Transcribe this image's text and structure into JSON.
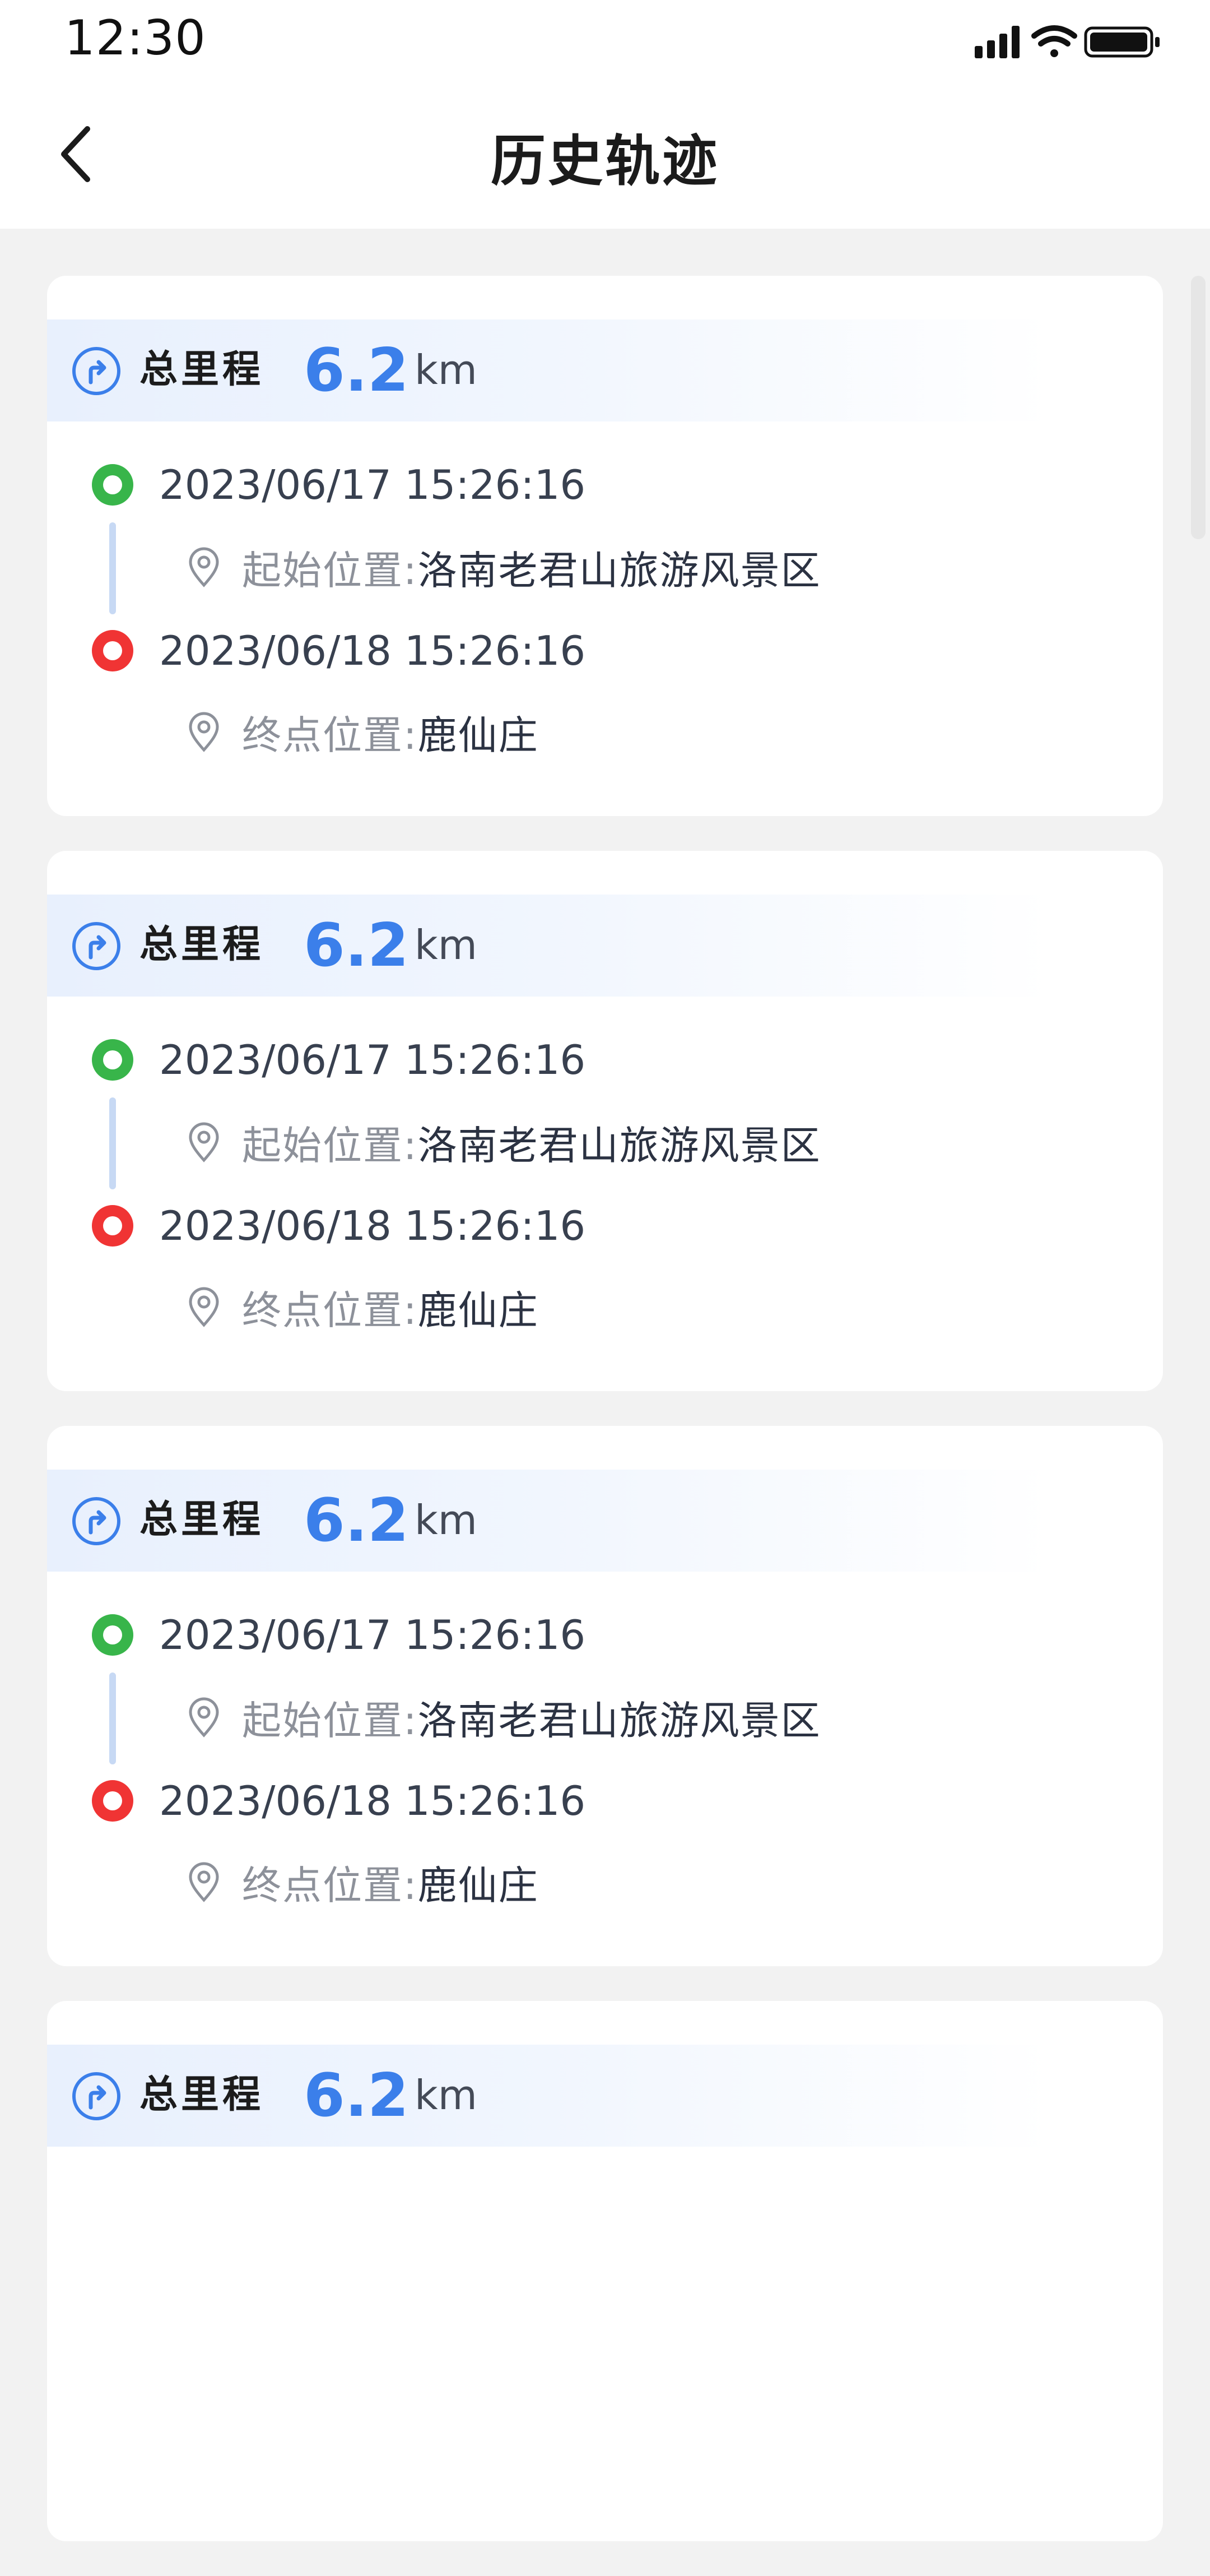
{
  "status_bar": {
    "time": "12:30",
    "icons": [
      "signal-icon",
      "wifi-icon",
      "battery-icon"
    ]
  },
  "nav": {
    "back_icon": "chevron-left-icon",
    "title": "历史轨迹"
  },
  "colors": {
    "accent": "#3b7fea",
    "start": "#38b54a",
    "end": "#f03434",
    "timeline": "#c7d9f4",
    "background": "#f2f2f2"
  },
  "trips": [
    {
      "total_label": "总里程",
      "distance": "6.2",
      "unit": "km",
      "start_time": "2023/06/17 15:26:16",
      "start_label": "起始位置:",
      "start_location": "洛南老君山旅游风景区",
      "end_time": "2023/06/18 15:26:16",
      "end_label": "终点位置:",
      "end_location": "鹿仙庄"
    },
    {
      "total_label": "总里程",
      "distance": "6.2",
      "unit": "km",
      "start_time": "2023/06/17 15:26:16",
      "start_label": "起始位置:",
      "start_location": "洛南老君山旅游风景区",
      "end_time": "2023/06/18 15:26:16",
      "end_label": "终点位置:",
      "end_location": "鹿仙庄"
    },
    {
      "total_label": "总里程",
      "distance": "6.2",
      "unit": "km",
      "start_time": "2023/06/17 15:26:16",
      "start_label": "起始位置:",
      "start_location": "洛南老君山旅游风景区",
      "end_time": "2023/06/18 15:26:16",
      "end_label": "终点位置:",
      "end_location": "鹿仙庄"
    },
    {
      "total_label": "总里程",
      "distance": "6.2",
      "unit": "km"
    }
  ]
}
